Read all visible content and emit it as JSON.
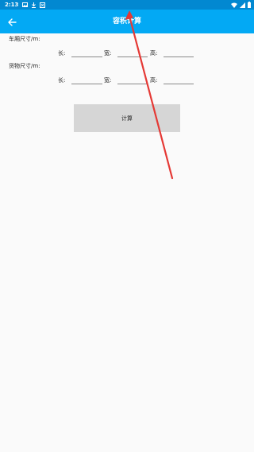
{
  "status_bar": {
    "time": "2:13",
    "left_icons": [
      "image-icon",
      "download-icon",
      "notification-icon"
    ],
    "right_icons": [
      "wifi-icon",
      "signal-icon",
      "battery-icon"
    ]
  },
  "app_bar": {
    "title": "容积计算",
    "back_icon": "arrow-back-icon",
    "background_color": "#03a9f4"
  },
  "container_section": {
    "label": "车厢尺寸/m:",
    "fields": [
      {
        "label": "长:",
        "value": ""
      },
      {
        "label": "宽:",
        "value": ""
      },
      {
        "label": "高:",
        "value": ""
      }
    ]
  },
  "cargo_section": {
    "label": "货物尺寸/m:",
    "fields": [
      {
        "label": "长:",
        "value": ""
      },
      {
        "label": "宽:",
        "value": ""
      },
      {
        "label": "高:",
        "value": ""
      }
    ]
  },
  "calculate_button": {
    "label": "计算"
  },
  "annotation": {
    "color": "#e53935"
  }
}
